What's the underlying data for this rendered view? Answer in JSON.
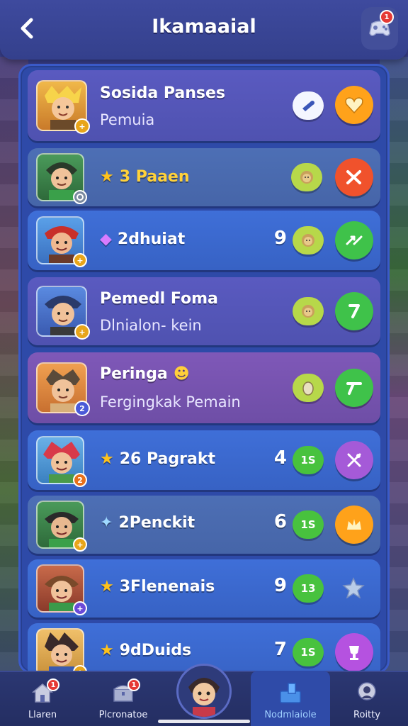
{
  "header": {
    "title": "Ikamaaial",
    "back_icon": "back-arrow-icon",
    "action_icon": "game-controller-icon",
    "action_badge": "1"
  },
  "rows": [
    {
      "name": "Sosida Panses",
      "subtitle": "Pemuia",
      "rank": "",
      "chip": "",
      "chip_icon": "toggle-icon",
      "button_icon": "heart-shield-icon",
      "avatar_badge": "+"
    },
    {
      "name": "3 Paaen",
      "subtitle": "",
      "rank": "",
      "chip": "",
      "chip_icon": "lion-icon",
      "button_icon": "swords-icon",
      "avatar_badge": ""
    },
    {
      "name": "2dhuiat",
      "subtitle": "",
      "rank": "9",
      "chip": "",
      "chip_icon": "lion-icon",
      "button_icon": "arrows-icon",
      "avatar_badge": "+"
    },
    {
      "name": "Pemedl Foma",
      "subtitle": "Dlnialon- kein",
      "rank": "",
      "chip": "",
      "chip_icon": "lion-icon",
      "button_icon": "sword-icon",
      "avatar_badge": "+"
    },
    {
      "name": "Peringa",
      "subtitle": "Fergingkak Pemain",
      "rank": "",
      "chip": "",
      "chip_icon": "egg-icon",
      "button_icon": "sword-icon",
      "avatar_badge": "2"
    },
    {
      "name": "26 Pagrakt",
      "subtitle": "",
      "rank": "4",
      "chip": "1S",
      "chip_icon": "",
      "button_icon": "crossed-tools-icon",
      "avatar_badge": "2"
    },
    {
      "name": "2Penckit",
      "subtitle": "",
      "rank": "6",
      "chip": "1S",
      "chip_icon": "",
      "button_icon": "crown-icon",
      "avatar_badge": "+"
    },
    {
      "name": "3Flenenais",
      "subtitle": "",
      "rank": "9",
      "chip": "13",
      "chip_icon": "",
      "button_icon": "star-icon",
      "avatar_badge": "+"
    },
    {
      "name": "9dDuids",
      "subtitle": "",
      "rank": "7",
      "chip": "1S",
      "chip_icon": "",
      "button_icon": "trophy-icon",
      "avatar_badge": "+"
    }
  ],
  "bottom_nav": [
    {
      "label": "Llaren",
      "icon": "home-icon",
      "badge": "1"
    },
    {
      "label": "Plcronatoe",
      "icon": "chest-icon",
      "badge": "1"
    },
    {
      "label": "Nodmlaiole",
      "icon": "leaderboard-icon",
      "badge": "",
      "active": true
    },
    {
      "label": "Roitty",
      "icon": "profile-icon",
      "badge": ""
    }
  ],
  "colors": {
    "accent": "#2e4aa8",
    "gold": "#ffd23a",
    "green": "#48c23e",
    "orange": "#ffa21a"
  }
}
